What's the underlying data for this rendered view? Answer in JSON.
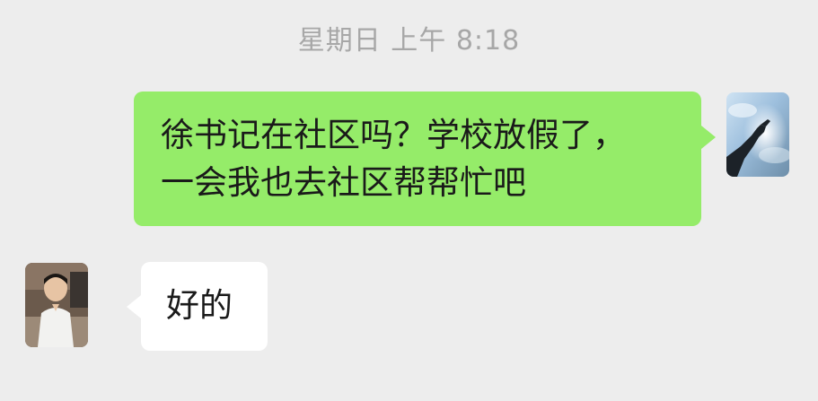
{
  "chat": {
    "timestamp": "星期日 上午 8:18",
    "messages": [
      {
        "sender": "self",
        "avatar_icon": "sky-hand-avatar-icon",
        "lines": [
          "徐书记在社区吗？学校放假了，",
          "一会我也去社区帮帮忙吧"
        ]
      },
      {
        "sender": "other",
        "avatar_icon": "boy-avatar-icon",
        "lines": [
          "好的"
        ]
      }
    ]
  },
  "colors": {
    "background": "#ededed",
    "outgoing_bubble": "#95ec69",
    "incoming_bubble": "#ffffff",
    "timestamp_text": "#a7a7a7"
  }
}
